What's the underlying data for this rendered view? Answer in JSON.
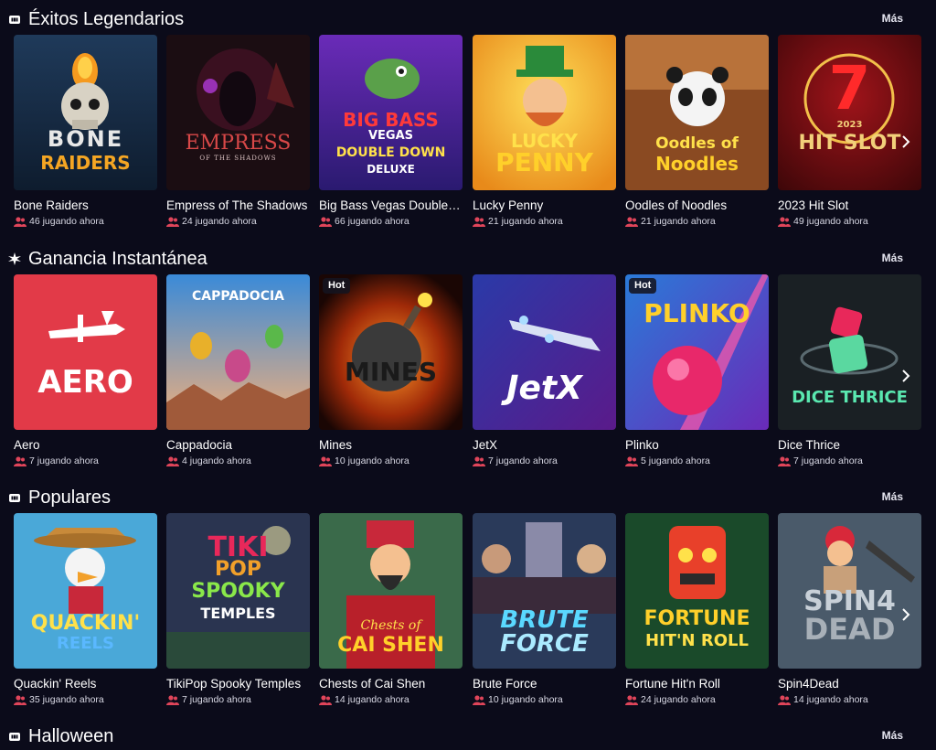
{
  "sections": [
    {
      "title": "Éxitos Legendarios",
      "icon": "game-icon",
      "more": "Más",
      "games": [
        {
          "name": "Bone Raiders",
          "players": "46 jugando ahora",
          "art": [
            "BONE",
            "RAIDERS"
          ]
        },
        {
          "name": "Empress of The Shadows",
          "players": "24 jugando ahora",
          "art": [
            "EMPRESS",
            "OF THE SHADOWS"
          ]
        },
        {
          "name": "Big Bass Vegas Double Down Deluxe",
          "players": "66 jugando ahora",
          "art": [
            "BIG BASS",
            "VEGAS",
            "DOUBLE DOWN",
            "DELUXE"
          ]
        },
        {
          "name": "Lucky Penny",
          "players": "21 jugando ahora",
          "art": [
            "LUCKY",
            "PENNY"
          ]
        },
        {
          "name": "Oodles of Noodles",
          "players": "21 jugando ahora",
          "art": [
            "Oodles of",
            "Noodles"
          ]
        },
        {
          "name": "2023 Hit Slot",
          "players": "49 jugando ahora",
          "art": [
            "7",
            "2023",
            "HIT SLOT"
          ]
        }
      ]
    },
    {
      "title": "Ganancia Instantánea",
      "icon": "burst-icon",
      "more": "Más",
      "games": [
        {
          "name": "Aero",
          "players": "7 jugando ahora",
          "art": [
            "AERO"
          ]
        },
        {
          "name": "Cappadocia",
          "players": "4 jugando ahora",
          "art": [
            "CAPPADOCIA"
          ]
        },
        {
          "name": "Mines",
          "players": "10 jugando ahora",
          "art": [
            "MINES"
          ],
          "badge": "Hot"
        },
        {
          "name": "JetX",
          "players": "7 jugando ahora",
          "art": [
            "JetX"
          ]
        },
        {
          "name": "Plinko",
          "players": "5 jugando ahora",
          "art": [
            "PLINKO"
          ],
          "badge": "Hot"
        },
        {
          "name": "Dice Thrice",
          "players": "7 jugando ahora",
          "art": [
            "DICE THRICE"
          ]
        }
      ]
    },
    {
      "title": "Populares",
      "icon": "game-icon",
      "more": "Más",
      "games": [
        {
          "name": "Quackin' Reels",
          "players": "35 jugando ahora",
          "art": [
            "QUACKIN'",
            "REELS"
          ]
        },
        {
          "name": "TikiPop Spooky Temples",
          "players": "7 jugando ahora",
          "art": [
            "TIKI",
            "POP",
            "SPOOKY",
            "TEMPLES"
          ]
        },
        {
          "name": "Chests of Cai Shen",
          "players": "14 jugando ahora",
          "art": [
            "Chests of",
            "CAI SHEN"
          ]
        },
        {
          "name": "Brute Force",
          "players": "10 jugando ahora",
          "art": [
            "BRUTE",
            "FORCE"
          ]
        },
        {
          "name": "Fortune Hit'n Roll",
          "players": "24 jugando ahora",
          "art": [
            "FORTUNE",
            "HIT'N ROLL"
          ]
        },
        {
          "name": "Spin4Dead",
          "players": "14 jugando ahora",
          "art": [
            "SPIN4",
            "DEAD"
          ]
        }
      ]
    },
    {
      "title": "Halloween",
      "icon": "game-icon",
      "more": "Más",
      "games": []
    }
  ],
  "colors": {
    "background": "#0b0b1a",
    "text": "#ffffff",
    "players_icon": "#e0455a",
    "hot_badge_bg": "#141420"
  }
}
